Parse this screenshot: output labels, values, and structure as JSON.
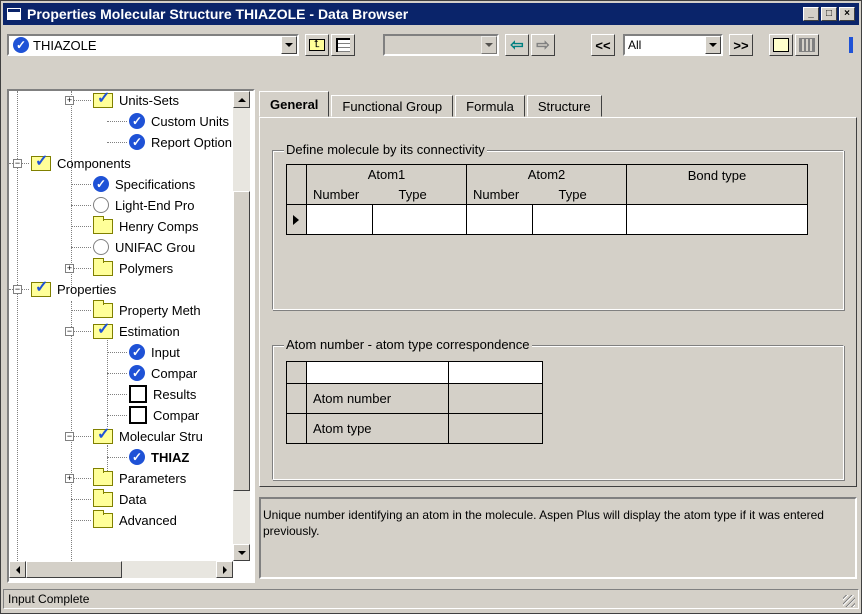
{
  "window": {
    "title": "Properties Molecular Structure THIAZOLE - Data Browser",
    "caption_buttons": [
      "_",
      "□",
      "×"
    ]
  },
  "toolbar": {
    "object_combo": {
      "value": "THIAZOLE",
      "icon": "check-icon"
    },
    "up_folder_icon": "folder-up-icon",
    "tree_toggle_icon": "tree-view-icon",
    "nav_combo_value": "",
    "back_icon": "arrow-left-icon",
    "forward_icon": "arrow-right-icon",
    "prev_label": "<<",
    "filter_combo_value": "All",
    "next_label": ">>",
    "notes_icon": "notes-icon",
    "status_icon": "status-icon"
  },
  "tree": {
    "items": [
      {
        "label": "Units-Sets",
        "icon": "folder-check-icon",
        "expander": "+",
        "bold": false
      },
      {
        "label": "Custom Units",
        "icon": "check-icon",
        "expander": "",
        "bold": false
      },
      {
        "label": "Report Option",
        "icon": "check-icon",
        "expander": "",
        "bold": false
      },
      {
        "label": "Components",
        "icon": "folder-check-icon",
        "expander": "-",
        "bold": false
      },
      {
        "label": "Specifications",
        "icon": "check-icon",
        "expander": "",
        "bold": false
      },
      {
        "label": "Light-End Pro",
        "icon": "circle-icon",
        "expander": "",
        "bold": false
      },
      {
        "label": "Henry Comps",
        "icon": "folder-icon",
        "expander": "",
        "bold": false
      },
      {
        "label": "UNIFAC Grou",
        "icon": "circle-icon",
        "expander": "",
        "bold": false
      },
      {
        "label": "Polymers",
        "icon": "folder-icon",
        "expander": "+",
        "bold": false
      },
      {
        "label": "Properties",
        "icon": "folder-check-icon",
        "expander": "-",
        "bold": false
      },
      {
        "label": "Property Meth",
        "icon": "folder-icon",
        "expander": "",
        "bold": false
      },
      {
        "label": "Estimation",
        "icon": "folder-check-icon",
        "expander": "-",
        "bold": false
      },
      {
        "label": "Input",
        "icon": "check-icon",
        "expander": "",
        "bold": false
      },
      {
        "label": "Compar",
        "icon": "check-icon",
        "expander": "",
        "bold": false
      },
      {
        "label": "Results",
        "icon": "square-icon",
        "expander": "",
        "bold": false
      },
      {
        "label": "Compar",
        "icon": "square-icon",
        "expander": "",
        "bold": false
      },
      {
        "label": "Molecular Stru",
        "icon": "folder-check-icon",
        "expander": "-",
        "bold": false
      },
      {
        "label": "THIAZ",
        "icon": "check-icon",
        "expander": "",
        "bold": true
      },
      {
        "label": "Parameters",
        "icon": "folder-icon",
        "expander": "+",
        "bold": false
      },
      {
        "label": "Data",
        "icon": "folder-icon",
        "expander": "",
        "bold": false
      },
      {
        "label": "Advanced",
        "icon": "folder-icon",
        "expander": "",
        "bold": false
      }
    ]
  },
  "tabs": [
    {
      "label": "General",
      "active": true
    },
    {
      "label": "Functional Group",
      "active": false
    },
    {
      "label": "Formula",
      "active": false
    },
    {
      "label": "Structure",
      "active": false
    }
  ],
  "connectivity": {
    "group_label": "Define molecule by its connectivity",
    "headers": {
      "atom1": "Atom1",
      "atom2": "Atom2",
      "bond_type": "Bond type",
      "number": "Number",
      "type": "Type"
    },
    "rows": [
      {
        "atom1_number": "",
        "atom1_type": "",
        "atom2_number": "",
        "atom2_type": "",
        "bond_type": ""
      }
    ]
  },
  "correspondence": {
    "group_label": "Atom number - atom type correspondence",
    "rows": [
      {
        "label": "",
        "value": ""
      },
      {
        "label": "Atom number",
        "value": ""
      },
      {
        "label": "Atom type",
        "value": ""
      }
    ]
  },
  "description": "Unique number identifying an atom in the molecule. Aspen Plus will display the atom type if it was entered previously.",
  "status": {
    "text": "Input Complete"
  },
  "colors": {
    "titlebar": "#0a246a",
    "face": "#d4d0c8",
    "check": "#1f52d6"
  }
}
